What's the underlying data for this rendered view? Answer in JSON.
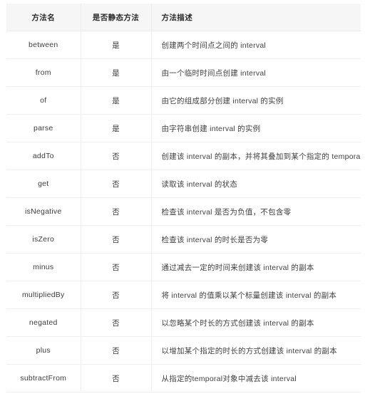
{
  "table": {
    "columns": [
      {
        "key": "name",
        "label": "方法名"
      },
      {
        "key": "static",
        "label": "是否静态方法"
      },
      {
        "key": "desc",
        "label": "方法描述"
      }
    ],
    "rows": [
      {
        "name": "between",
        "static": "是",
        "desc": "创建两个时间点之间的 interval"
      },
      {
        "name": "from",
        "static": "是",
        "desc": "由一个临时时间点创建 interval"
      },
      {
        "name": "of",
        "static": "是",
        "desc": "由它的组成部分创建 interval 的实例"
      },
      {
        "name": "parse",
        "static": "是",
        "desc": "由字符串创建 interval 的实例"
      },
      {
        "name": "addTo",
        "static": "否",
        "desc": "创建该 interval 的副本，并将其叠加到某个指定的 temporal 对象"
      },
      {
        "name": "get",
        "static": "否",
        "desc": "读取该 interval 的状态"
      },
      {
        "name": "isNegative",
        "static": "否",
        "desc": "检查该 interval 是否为负值，不包含零"
      },
      {
        "name": "isZero",
        "static": "否",
        "desc": "检查该 interval 的时长是否为零"
      },
      {
        "name": "minus",
        "static": "否",
        "desc": "通过减去一定的时间来创建该 interval 的副本"
      },
      {
        "name": "multipliedBy",
        "static": "否",
        "desc": "将 interval 的值乘以某个标量创建该 interval 的副本"
      },
      {
        "name": "negated",
        "static": "否",
        "desc": "以忽略某个时长的方式创建该 interval 的副本"
      },
      {
        "name": "plus",
        "static": "否",
        "desc": "以增加某个指定的时长的方式创建该 interval 的副本"
      },
      {
        "name": "subtractFrom",
        "static": "否",
        "desc": "从指定的temporal对象中减去该 interval"
      }
    ]
  },
  "colors": {
    "header_bg": "#f6f6f6",
    "row_bg": "#ffffff",
    "border": "#f0f0f0",
    "text": "#3a3a3a",
    "header_text": "#2b2b2b"
  }
}
